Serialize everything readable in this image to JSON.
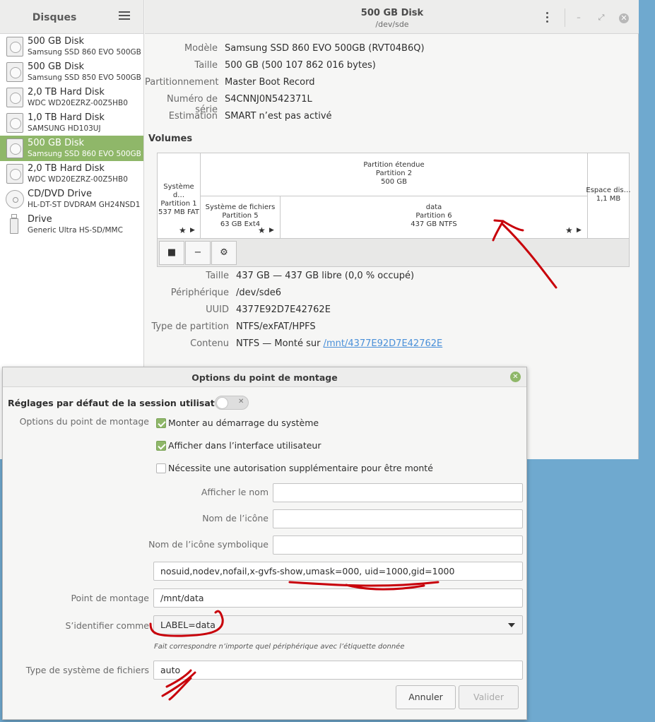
{
  "sidebar": {
    "title": "Disques",
    "items": [
      {
        "name": "500 GB Disk",
        "sub": "Samsung SSD 860 EVO 500GB"
      },
      {
        "name": "500 GB Disk",
        "sub": "Samsung SSD 850 EVO 500GB"
      },
      {
        "name": "2,0 TB Hard Disk",
        "sub": "WDC WD20EZRZ-00Z5HB0"
      },
      {
        "name": "1,0 TB Hard Disk",
        "sub": "SAMSUNG HD103UJ"
      },
      {
        "name": "500 GB Disk",
        "sub": "Samsung SSD 860 EVO 500GB"
      },
      {
        "name": "2,0 TB Hard Disk",
        "sub": "WDC WD20EZRZ-00Z5HB0"
      },
      {
        "name": "CD/DVD Drive",
        "sub": "HL-DT-ST DVDRAM GH24NSD1"
      },
      {
        "name": "Drive",
        "sub": "Generic Ultra HS-SD/MMC"
      }
    ],
    "selected_index": 4
  },
  "header": {
    "title": "500 GB Disk",
    "subtitle": "/dev/sde"
  },
  "disk_info": {
    "model_label": "Modèle",
    "model": "Samsung SSD 860 EVO 500GB (RVT04B6Q)",
    "size_label": "Taille",
    "size": "500 GB (500 107 862 016 bytes)",
    "partitioning_label": "Partitionnement",
    "partitioning": "Master Boot Record",
    "serial_label": "Numéro de série",
    "serial": "S4CNNJ0N542371L",
    "assessment_label": "Estimation",
    "assessment": "SMART n’est pas activé"
  },
  "volumes": {
    "title": "Volumes",
    "p1": {
      "line1": "Système d…",
      "line2": "Partition 1",
      "line3": "537 MB FAT"
    },
    "extended": {
      "line1": "Partition étendue",
      "line2": "Partition 2",
      "line3": "500 GB"
    },
    "p5": {
      "line1": "Système de fichiers",
      "line2": "Partition 5",
      "line3": "63 GB Ext4"
    },
    "p6": {
      "line1": "data",
      "line2": "Partition 6",
      "line3": "437 GB NTFS"
    },
    "free": {
      "line1": "Espace dis…",
      "line2": "1,1 MB"
    },
    "toolbar": {
      "stop": "■",
      "minus": "−",
      "gear": "⚙"
    }
  },
  "partition_info": {
    "size_label": "Taille",
    "size": "437 GB — 437 GB libre (0,0 % occupé)",
    "device_label": "Périphérique",
    "device": "/dev/sde6",
    "uuid_label": "UUID",
    "uuid": "4377E92D7E42762E",
    "type_label": "Type de partition",
    "type": "NTFS/exFAT/HPFS",
    "contents_label": "Contenu",
    "contents_prefix": "NTFS — Monté sur ",
    "contents_link": "/mnt/4377E92D7E42762E"
  },
  "dialog": {
    "title": "Options du point de montage",
    "session_default": "Réglages par défaut de la session utilisateur",
    "toggle_x": "✕",
    "options_label": "Options du point de montage",
    "cb_startup": "Monter au démarrage du système",
    "cb_show_ui": "Afficher dans l’interface utilisateur",
    "cb_auth": "Nécessite une autorisation supplémentaire pour être monté",
    "display_name_label": "Afficher le nom",
    "icon_name_label": "Nom de l’icône",
    "symbolic_icon_label": "Nom de l’icône symbolique",
    "mount_options_value": "nosuid,nodev,nofail,x-gvfs-show,umask=000, uid=1000,gid=1000",
    "mount_point_label": "Point de montage",
    "mount_point_value": "/mnt/data",
    "identify_label": "S’identifier comme",
    "identify_value": "LABEL=data",
    "identify_hint": "Fait correspondre n’importe quel périphérique avec l’étiquette donnée",
    "fs_type_label": "Type de système de fichiers",
    "fs_type_value": "auto",
    "cancel_label": "Annuler",
    "ok_label": "Valider",
    "close_glyph": "✕"
  },
  "window_controls": {
    "minimize": "–",
    "restore": "⤢",
    "close": "✕"
  },
  "colors": {
    "accent": "#8fb769",
    "annotation": "#c8000a",
    "link": "#4a90d9"
  }
}
